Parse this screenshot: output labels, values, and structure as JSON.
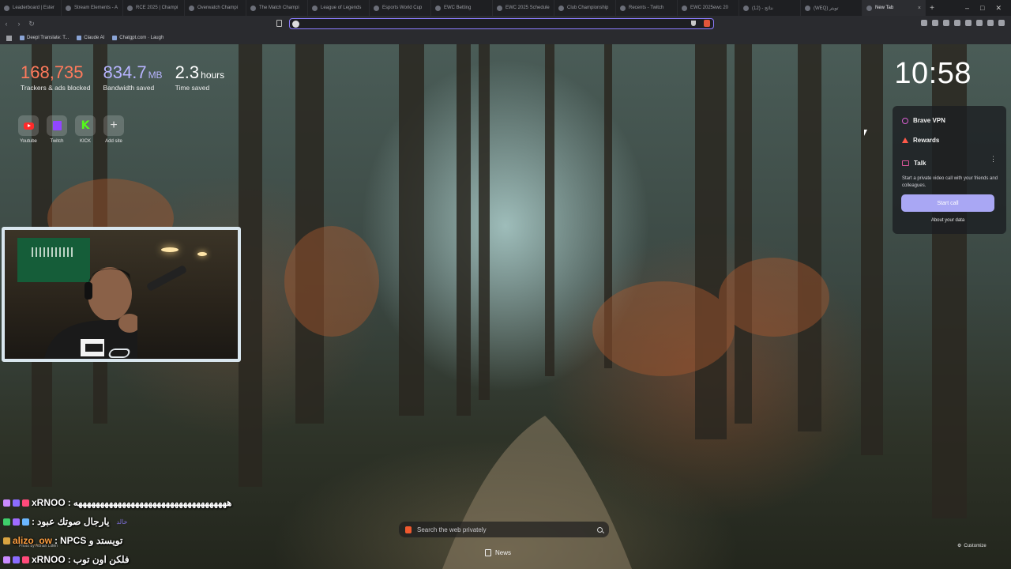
{
  "browser": {
    "tabs": [
      {
        "label": "Leaderboard | Ester"
      },
      {
        "label": "Stream Elements - A"
      },
      {
        "label": "RCE 2025 | Champi"
      },
      {
        "label": "Overwatch Champi"
      },
      {
        "label": "The Match Champi"
      },
      {
        "label": "League of Legends"
      },
      {
        "label": "Esports World Cup"
      },
      {
        "label": "EWC Betting"
      },
      {
        "label": "EWC 2025 Schedule"
      },
      {
        "label": "Club Championship"
      },
      {
        "label": "Recents - Twitch"
      },
      {
        "label": "EWC 2025ewc 20"
      },
      {
        "label": "نتائج - (12)"
      },
      {
        "label": "(WEQ) تويتر"
      },
      {
        "label": "New Tab",
        "active": true
      }
    ],
    "new_tab_symbol": "+",
    "address_value": "",
    "bookmarks": [
      {
        "label": "Deepl Translate: T..."
      },
      {
        "label": "Claude AI"
      },
      {
        "label": "Chatgpt.com · Laugh"
      }
    ]
  },
  "ntp": {
    "stats": {
      "trackers_value": "168,735",
      "trackers_label": "Trackers & ads blocked",
      "bandwidth_value": "834.7",
      "bandwidth_unit": "MB",
      "bandwidth_label": "Bandwidth saved",
      "time_value": "2.3",
      "time_unit": "hours",
      "time_label": "Time saved"
    },
    "shortcuts": [
      {
        "label": "Youtube",
        "icon": "youtube-icon"
      },
      {
        "label": "Twitch",
        "icon": "twitch-icon"
      },
      {
        "label": "KICK",
        "icon": "kick-icon"
      },
      {
        "label": "Add site",
        "icon": "plus-icon"
      }
    ],
    "clock": "10:58",
    "widgets": {
      "vpn_label": "Brave VPN",
      "rewards_label": "Rewards",
      "talk_label": "Talk",
      "talk_description": "Start a private video call with your friends and colleagues.",
      "start_call_label": "Start call",
      "about_data_label": "About your data"
    },
    "search_placeholder": "Search the web privately",
    "news_label": "News",
    "customize_label": "Customize",
    "photo_credit": "Photo by Adrian Litteri"
  },
  "chat": [
    {
      "name": "xRNOO",
      "sep": ":",
      "message": "هههههههههههههههههههههههههههههههههههه",
      "name_color": "#ffffff",
      "badges": [
        "#c98bff",
        "#8b6cff",
        "#ff4a7a"
      ]
    },
    {
      "name": "",
      "sep": ":",
      "message": "يارجال صوتك عبود",
      "alt": "خالد",
      "name_color": "#ffffff",
      "badges": [
        "#3fd06b",
        "#a06bff",
        "#6bb7ff"
      ]
    },
    {
      "name": "alizo_ow",
      "sep": ":",
      "message": "NPCS تويستد و",
      "name_color": "#ff9f40",
      "badges": [
        "#d9a441"
      ]
    },
    {
      "name": "xRNOO",
      "sep": ":",
      "message": "فلكن اون توب",
      "name_color": "#ffffff",
      "badges": [
        "#c98bff",
        "#8b6cff",
        "#ff4a7a"
      ]
    }
  ]
}
